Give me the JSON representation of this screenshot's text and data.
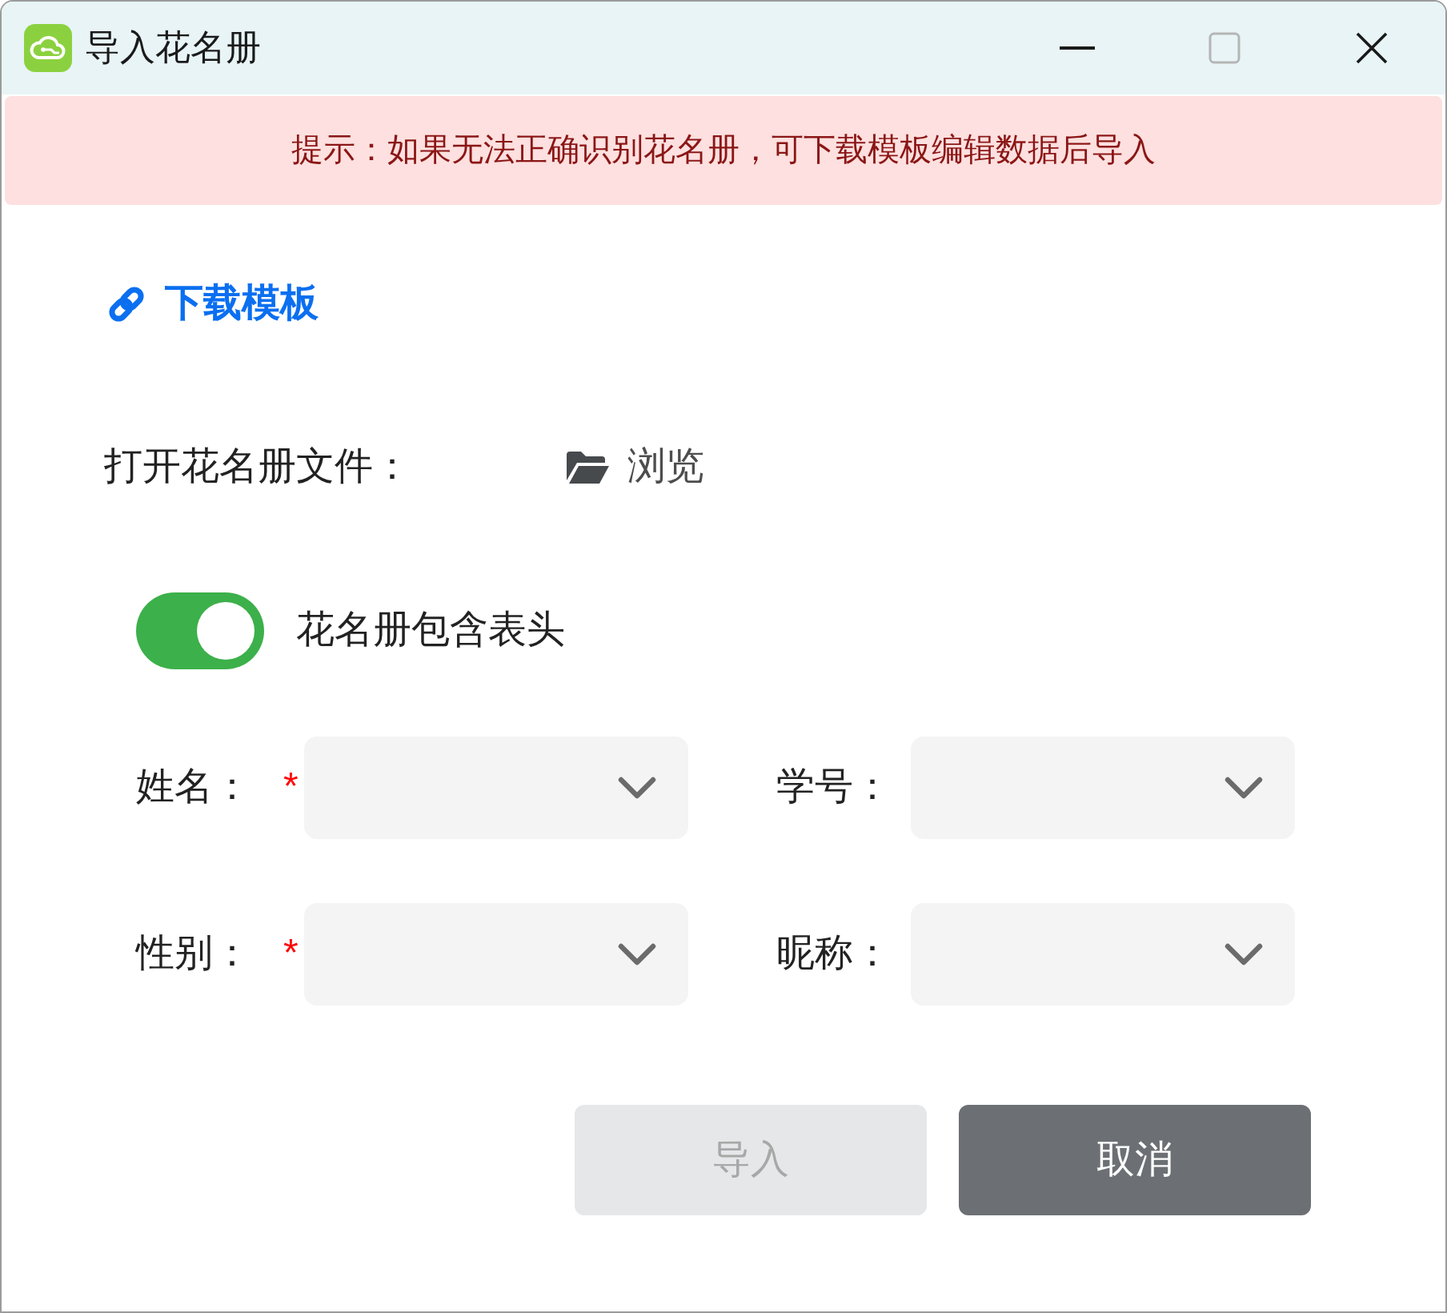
{
  "window": {
    "title": "导入花名册",
    "maximize_disabled": true
  },
  "alert": {
    "text": "提示：如果无法正确识别花名册，可下载模板编辑数据后导入"
  },
  "download_link": {
    "label": "下载模板"
  },
  "file_picker": {
    "label": "打开花名册文件：",
    "browse_label": "浏览"
  },
  "header_switch": {
    "label": "花名册包含表头",
    "on": true
  },
  "fields": [
    {
      "label": "姓名：",
      "required_mark": "*"
    },
    {
      "label": "学号："
    },
    {
      "label": "性别：",
      "required_mark": "*"
    },
    {
      "label": "昵称："
    }
  ],
  "buttons": [
    {
      "label": "导入",
      "disabled": true
    },
    {
      "label": "取消",
      "disabled": false
    }
  ]
}
